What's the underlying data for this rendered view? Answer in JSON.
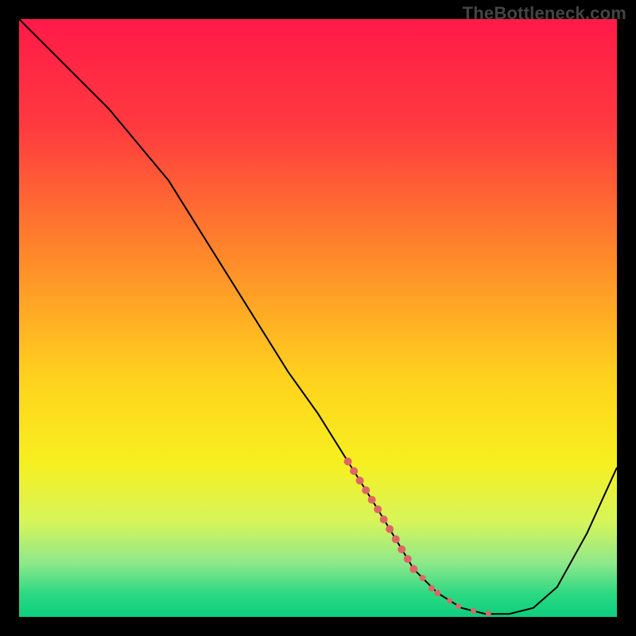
{
  "watermark": "TheBottleneck.com",
  "chart_data": {
    "type": "line",
    "title": "",
    "xlabel": "",
    "ylabel": "",
    "xlim": [
      0,
      100
    ],
    "ylim": [
      0,
      100
    ],
    "grid": false,
    "legend": false,
    "series": [
      {
        "name": "bottleneck-curve",
        "color": "#000000",
        "stroke_width": 2,
        "x": [
          0,
          5,
          10,
          15,
          20,
          25,
          30,
          35,
          40,
          45,
          50,
          55,
          60,
          63,
          66,
          70,
          74,
          78,
          82,
          86,
          90,
          95,
          100
        ],
        "y": [
          100,
          95,
          90,
          85,
          79,
          73,
          65,
          57,
          49,
          41,
          34,
          26,
          18,
          13,
          8,
          4,
          1.5,
          0.5,
          0.5,
          1.5,
          5,
          14,
          25
        ]
      }
    ],
    "highlight": {
      "color": "#e06666",
      "points": [
        {
          "x": 55,
          "y": 26,
          "r": 5
        },
        {
          "x": 56,
          "y": 24.4,
          "r": 5
        },
        {
          "x": 57,
          "y": 22.8,
          "r": 5
        },
        {
          "x": 58,
          "y": 21.2,
          "r": 5
        },
        {
          "x": 59,
          "y": 19.6,
          "r": 5
        },
        {
          "x": 60,
          "y": 18,
          "r": 5
        },
        {
          "x": 61,
          "y": 16.3,
          "r": 5
        },
        {
          "x": 62,
          "y": 14.7,
          "r": 5
        },
        {
          "x": 63,
          "y": 13,
          "r": 5
        },
        {
          "x": 64,
          "y": 11.3,
          "r": 5
        },
        {
          "x": 65,
          "y": 9.7,
          "r": 5
        },
        {
          "x": 66,
          "y": 8,
          "r": 5
        },
        {
          "x": 67.5,
          "y": 6.5,
          "r": 4
        },
        {
          "x": 69,
          "y": 4.8,
          "r": 4
        },
        {
          "x": 70,
          "y": 4,
          "r": 4
        },
        {
          "x": 72,
          "y": 2.7,
          "r": 3.5
        },
        {
          "x": 73.5,
          "y": 1.8,
          "r": 3.5
        },
        {
          "x": 76,
          "y": 1,
          "r": 3.5
        },
        {
          "x": 78.5,
          "y": 0.6,
          "r": 3.5
        }
      ]
    },
    "background_gradient": {
      "stops": [
        {
          "offset": 0.0,
          "color": "#ff1a48"
        },
        {
          "offset": 0.18,
          "color": "#ff3a3f"
        },
        {
          "offset": 0.4,
          "color": "#ff8a2a"
        },
        {
          "offset": 0.6,
          "color": "#ffd21e"
        },
        {
          "offset": 0.74,
          "color": "#f7ef1f"
        },
        {
          "offset": 0.84,
          "color": "#d7f55a"
        },
        {
          "offset": 0.91,
          "color": "#8ee88a"
        },
        {
          "offset": 0.96,
          "color": "#2fd983"
        },
        {
          "offset": 1.0,
          "color": "#0bcf7d"
        }
      ]
    }
  }
}
